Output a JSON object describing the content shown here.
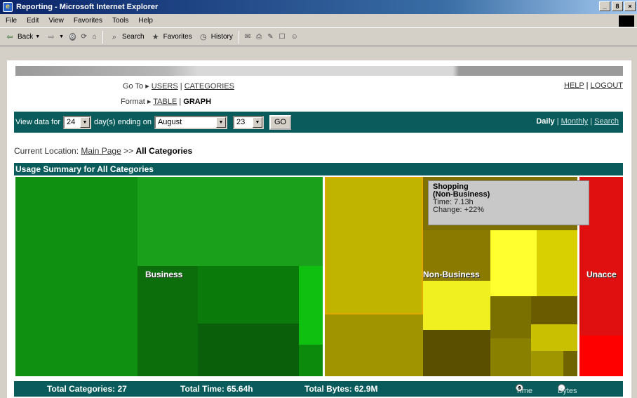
{
  "window": {
    "title": "Reporting - Microsoft Internet Explorer",
    "controls": [
      "_",
      "8",
      "×"
    ]
  },
  "menu": [
    "File",
    "Edit",
    "View",
    "Favorites",
    "Tools",
    "Help"
  ],
  "toolbar": {
    "back": "Back",
    "search": "Search",
    "favorites": "Favorites",
    "history": "History"
  },
  "nav": {
    "goto_prefix": "Go To ▸",
    "users": "USERS",
    "categories": "CATEGORIES",
    "format_prefix": "Format ▸",
    "table": "TABLE",
    "graph": "GRAPH",
    "help": "HELP",
    "logout": "LOGOUT"
  },
  "view": {
    "label": "View data for",
    "days": "24",
    "days_suffix": "day(s) ending on",
    "month": "August",
    "date": "23",
    "go": "GO",
    "daily": "Daily",
    "monthly": "Monthly",
    "search": "Search"
  },
  "location": {
    "prefix": "Current Location:",
    "main": "Main Page",
    "sep": ">>",
    "current": "All Categories"
  },
  "summary": {
    "title": "Usage Summary for All Categories"
  },
  "treemap": {
    "labels": {
      "business": "Business",
      "nonbusiness": "Non-Business",
      "unacc": "Unacce"
    },
    "tooltip": {
      "line1": "Shopping",
      "line2": "(Non-Business)",
      "time": "Time: 7.13h",
      "change": "Change: +22%"
    }
  },
  "footer": {
    "categories": "Total Categories: 27",
    "time": "Total Time: 65.64h",
    "bytes": "Total Bytes: 62.9M",
    "radio_time": "Time",
    "radio_bytes": "Bytes"
  }
}
